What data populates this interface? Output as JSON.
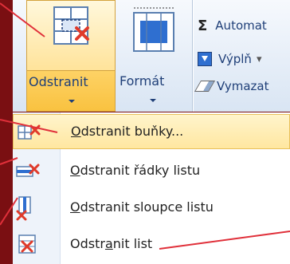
{
  "ribbon": {
    "delete_button": {
      "label": "Odstranit",
      "icon": "delete-cells-icon"
    },
    "format_button": {
      "label": "Formát",
      "icon": "format-cells-icon"
    },
    "editing": {
      "autosum": {
        "symbol": "Σ",
        "label": "Automat"
      },
      "fill": {
        "label": "Výplň",
        "arrow": "▾",
        "icon": "fill-down-icon"
      },
      "clear": {
        "label": "Vymazat",
        "icon": "eraser-icon"
      }
    }
  },
  "menu": {
    "items": [
      {
        "label": "Odstranit buňky...",
        "mnemonic": "O",
        "icon": "delete-cells-icon",
        "highlighted": true
      },
      {
        "label": "Odstranit řádky listu",
        "mnemonic": "O",
        "icon": "delete-rows-icon",
        "highlighted": false
      },
      {
        "label": "Odstranit sloupce listu",
        "mnemonic": "O",
        "icon": "delete-columns-icon",
        "highlighted": false
      },
      {
        "label": "Odstranit list",
        "mnemonic": "a",
        "icon": "delete-sheet-icon",
        "highlighted": false
      }
    ]
  },
  "colors": {
    "background": "#7a0f12",
    "ribbon_text": "#1f3f78",
    "highlight": "#ffd873",
    "annotation_line": "#e0303a"
  }
}
